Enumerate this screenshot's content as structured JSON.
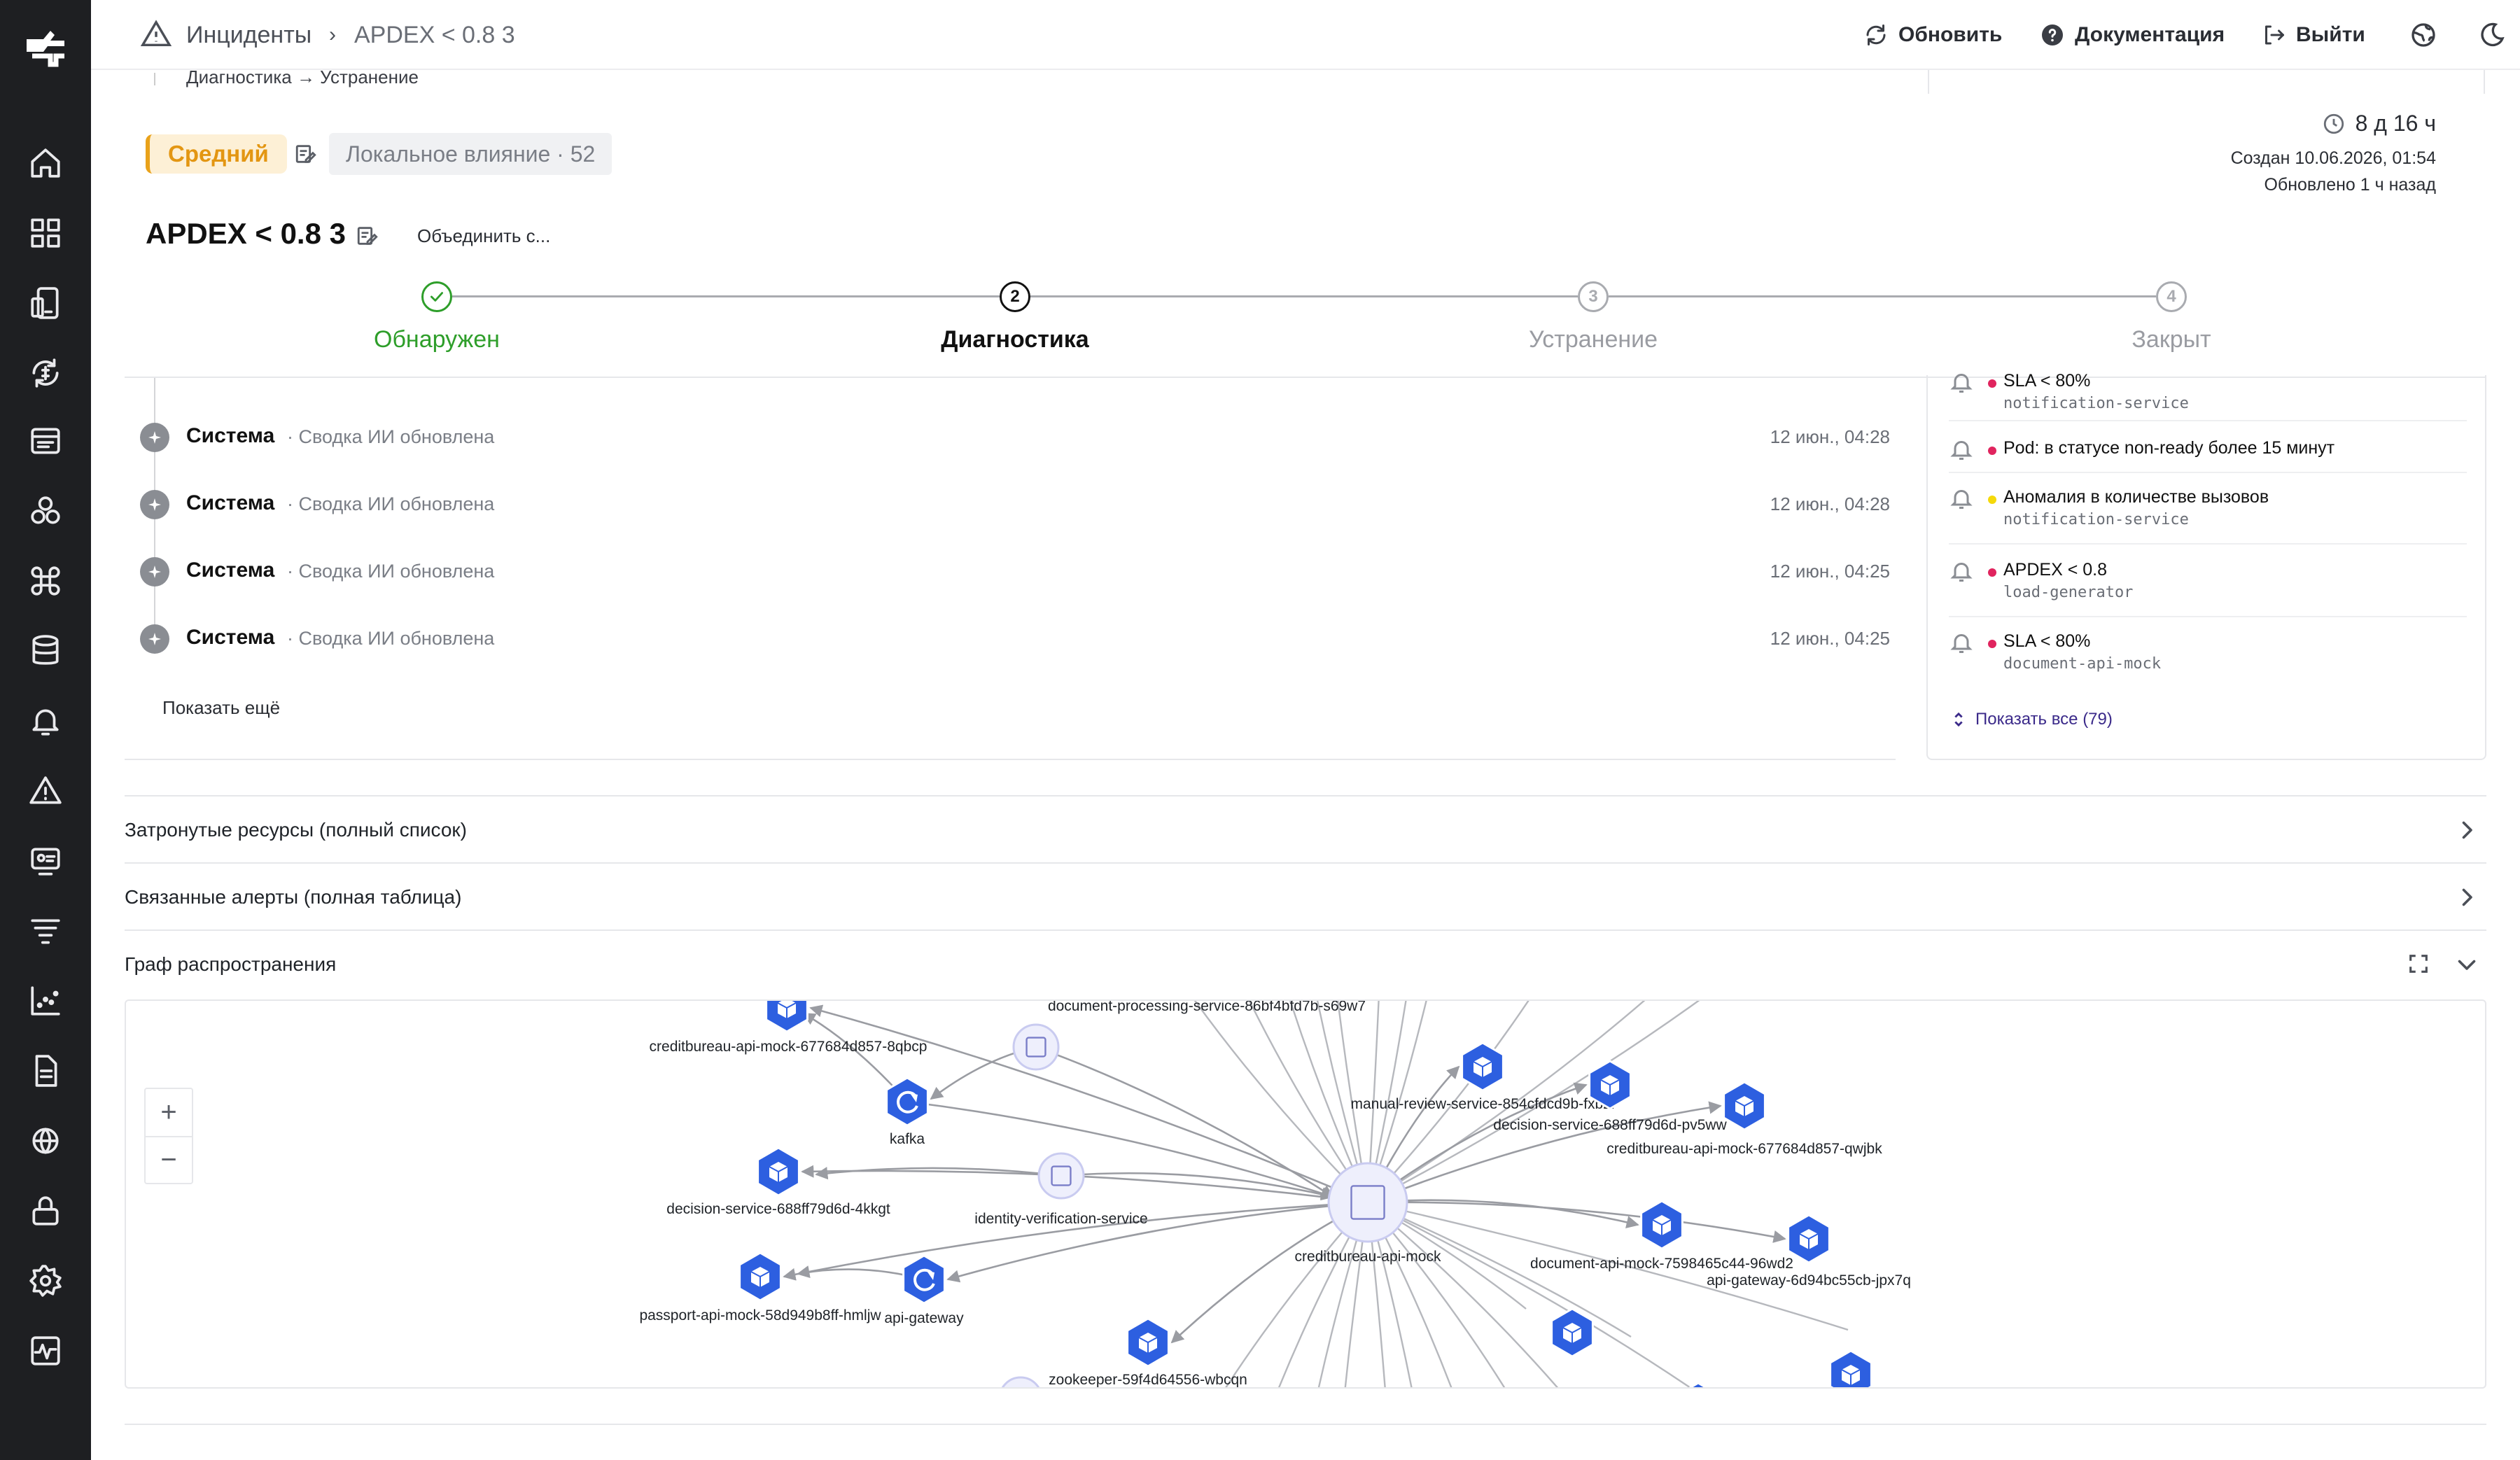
{
  "header": {
    "breadcrumb_root": "Инциденты",
    "breadcrumb_sep": "›",
    "breadcrumb_current": "APDEX < 0.8 3",
    "refresh_label": "Обновить",
    "docs_label": "Документация",
    "logout_label": "Выйти"
  },
  "subcrumb": "Диагностика → Устранение",
  "incident": {
    "severity": "Средний",
    "impact": "Локальное влияние · 52",
    "title": "APDEX < 0.8 3",
    "merge_label": "Объединить с...",
    "duration": "8 д 16 ч",
    "created": "Создан 10.06.2026, 01:54",
    "updated": "Обновлено 1 ч назад"
  },
  "stepper": [
    {
      "num": "",
      "label": "Обнаружен",
      "state": "done"
    },
    {
      "num": "2",
      "label": "Диагностика",
      "state": "active"
    },
    {
      "num": "3",
      "label": "Устранение",
      "state": "pending"
    },
    {
      "num": "4",
      "label": "Закрыт",
      "state": "pending"
    }
  ],
  "timeline": [
    {
      "who": "Система",
      "what": "· Сводка ИИ обновлена",
      "time": "12 июн., 04:28"
    },
    {
      "who": "Система",
      "what": "· Сводка ИИ обновлена",
      "time": "12 июн., 04:28"
    },
    {
      "who": "Система",
      "what": "· Сводка ИИ обновлена",
      "time": "12 июн., 04:25"
    },
    {
      "who": "Система",
      "what": "· Сводка ИИ обновлена",
      "time": "12 июн., 04:25"
    }
  ],
  "timeline_show_more": "Показать ещё",
  "alerts": {
    "items": [
      {
        "title": "SLA < 80%",
        "service": "notification-service",
        "color": "#e0245e"
      },
      {
        "title": "Pod: в статусе non-ready более 15 минут",
        "service": "",
        "color": "#e0245e"
      },
      {
        "title": "Аномалия в количестве вызовов",
        "service": "notification-service",
        "color": "#f5d90a"
      },
      {
        "title": "APDEX < 0.8",
        "service": "load-generator",
        "color": "#e0245e"
      },
      {
        "title": "SLA < 80%",
        "service": "document-api-mock",
        "color": "#e0245e"
      }
    ],
    "show_all": "Показать все (79)"
  },
  "sections": {
    "affected": "Затронутые ресурсы (полный список)",
    "related": "Связанные алерты (полная таблица)",
    "graph": "Граф распространения"
  },
  "graph": {
    "center_label": "creditbureau-api-mock",
    "nodes": [
      {
        "id": "cb1",
        "label": "creditbureau-api-mock-677684d857-8qbcp",
        "kind": "pod"
      },
      {
        "id": "dps",
        "label": "document-processing-service-86bf4bfd7b-s69w7",
        "kind": "service"
      },
      {
        "id": "kafka",
        "label": "kafka",
        "kind": "statefulset"
      },
      {
        "id": "ds1",
        "label": "decision-service-688ff79d6d-4kkgt",
        "kind": "pod"
      },
      {
        "id": "ivs",
        "label": "identity-verification-service",
        "kind": "service"
      },
      {
        "id": "pm",
        "label": "passport-api-mock-58d949b8ff-hmljw",
        "kind": "pod"
      },
      {
        "id": "agw",
        "label": "api-gateway",
        "kind": "statefulset"
      },
      {
        "id": "zk",
        "label": "zookeeper-59f4d64556-wbcqn",
        "kind": "pod"
      },
      {
        "id": "mrs",
        "label": "manual-review-service-854cfdcd9b-fxb2l",
        "kind": "pod"
      },
      {
        "id": "ds2",
        "label": "decision-service-688ff79d6d-pv5ww",
        "kind": "pod"
      },
      {
        "id": "cb2",
        "label": "creditbureau-api-mock-677684d857-qwjbk",
        "kind": "pod"
      },
      {
        "id": "dam",
        "label": "document-api-mock-7598465c44-96wd2",
        "kind": "pod"
      },
      {
        "id": "agw2",
        "label": "api-gateway-6d94bc55cb-jpx7q",
        "kind": "pod"
      }
    ]
  },
  "icons": {
    "logo": "logo-icon",
    "nav": [
      "home-icon",
      "dashboard-icon",
      "devices-icon",
      "sync-icon",
      "logs-icon",
      "cluster-icon",
      "command-icon",
      "database-icon",
      "bell-icon",
      "warning-icon",
      "monitor-icon",
      "filter-icon",
      "chart-icon",
      "document-icon",
      "network-icon",
      "lock-icon",
      "settings-icon",
      "activity-icon"
    ]
  },
  "colors": {
    "sidebar": "#1e1f22",
    "severity": "#e39612",
    "done": "#2e9e2a",
    "node": "#2d5fe0",
    "link": "#3b2a8a"
  }
}
